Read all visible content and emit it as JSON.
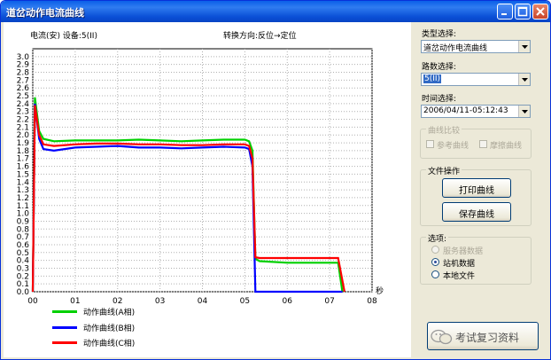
{
  "window": {
    "title": "道岔动作电流曲线"
  },
  "chart": {
    "header_left": "电流(安) 设备:5(II)",
    "header_center": "转换方向:反位→定位",
    "x_unit": "秒"
  },
  "chart_data": {
    "type": "line",
    "ylabel": "电流(安)",
    "xlabel": "秒",
    "ylim": [
      0.0,
      3.1
    ],
    "xlim": [
      0,
      8
    ],
    "y_ticks": [
      "3.0",
      "2.9",
      "2.8",
      "2.7",
      "2.6",
      "2.5",
      "2.4",
      "2.3",
      "2.2",
      "2.1",
      "2.0",
      "1.9",
      "1.8",
      "1.7",
      "1.6",
      "1.5",
      "1.4",
      "1.3",
      "1.2",
      "1.1",
      "1.0",
      "0.9",
      "0.8",
      "0.7",
      "0.6",
      "0.5",
      "0.4",
      "0.3",
      "0.2",
      "0.1",
      "0.0"
    ],
    "x_ticks": [
      "00",
      "01",
      "02",
      "03",
      "04",
      "05",
      "06",
      "07",
      "08"
    ],
    "grid": true,
    "legend_position": "bottom-left",
    "series": [
      {
        "name": "动作曲线(A相)",
        "color": "#00d000",
        "x": [
          0.0,
          0.05,
          0.15,
          0.25,
          0.5,
          1.0,
          1.5,
          2.0,
          2.5,
          3.0,
          3.5,
          4.0,
          4.5,
          5.0,
          5.1,
          5.18,
          5.25,
          5.35,
          6.0,
          6.5,
          7.0,
          7.2,
          7.3
        ],
        "y": [
          0.0,
          2.48,
          2.05,
          1.95,
          1.92,
          1.93,
          1.93,
          1.93,
          1.94,
          1.93,
          1.92,
          1.93,
          1.94,
          1.94,
          1.92,
          1.8,
          0.42,
          0.39,
          0.37,
          0.37,
          0.37,
          0.37,
          0.0
        ]
      },
      {
        "name": "动作曲线(B相)",
        "color": "#0000ff",
        "x": [
          0.0,
          0.05,
          0.15,
          0.25,
          0.5,
          1.0,
          1.5,
          2.0,
          2.5,
          3.0,
          3.5,
          4.0,
          4.5,
          5.0,
          5.1,
          5.18,
          5.25,
          6.0,
          7.0,
          7.3
        ],
        "y": [
          0.0,
          2.4,
          1.95,
          1.82,
          1.8,
          1.84,
          1.85,
          1.86,
          1.84,
          1.84,
          1.83,
          1.84,
          1.85,
          1.84,
          1.82,
          1.6,
          0.0,
          0.0,
          0.0,
          0.0
        ]
      },
      {
        "name": "动作曲线(C相)",
        "color": "#ff0000",
        "x": [
          0.0,
          0.05,
          0.15,
          0.25,
          0.5,
          1.0,
          1.5,
          2.0,
          2.5,
          3.0,
          3.5,
          4.0,
          4.5,
          5.0,
          5.1,
          5.18,
          5.25,
          5.35,
          6.0,
          6.5,
          7.0,
          7.2,
          7.35
        ],
        "y": [
          0.0,
          2.38,
          2.0,
          1.88,
          1.86,
          1.88,
          1.89,
          1.89,
          1.88,
          1.88,
          1.87,
          1.87,
          1.88,
          1.88,
          1.86,
          1.7,
          0.44,
          0.43,
          0.43,
          0.43,
          0.43,
          0.43,
          0.0
        ]
      }
    ]
  },
  "legend": [
    {
      "label": "动作曲线(A相)",
      "color": "#00d000"
    },
    {
      "label": "动作曲线(B相)",
      "color": "#0000ff"
    },
    {
      "label": "动作曲线(C相)",
      "color": "#ff0000"
    }
  ],
  "panel": {
    "type_label": "类型选择:",
    "type_value": "道岔动作电流曲线",
    "route_label": "路数选择:",
    "route_value": "5(II)",
    "time_label": "时间选择:",
    "time_value": "2006/04/11-05:12:43",
    "compare": {
      "title": "曲线比较",
      "ref_label": "参考曲线",
      "friction_label": "摩擦曲线"
    },
    "file_ops": {
      "title": "文件操作",
      "print_label": "打印曲线",
      "save_label": "保存曲线"
    },
    "options": {
      "title": "选项:",
      "server": "服务器数据",
      "station": "站机数据",
      "local": "本地文件"
    }
  },
  "watermark": {
    "text": "考试复习资料"
  }
}
